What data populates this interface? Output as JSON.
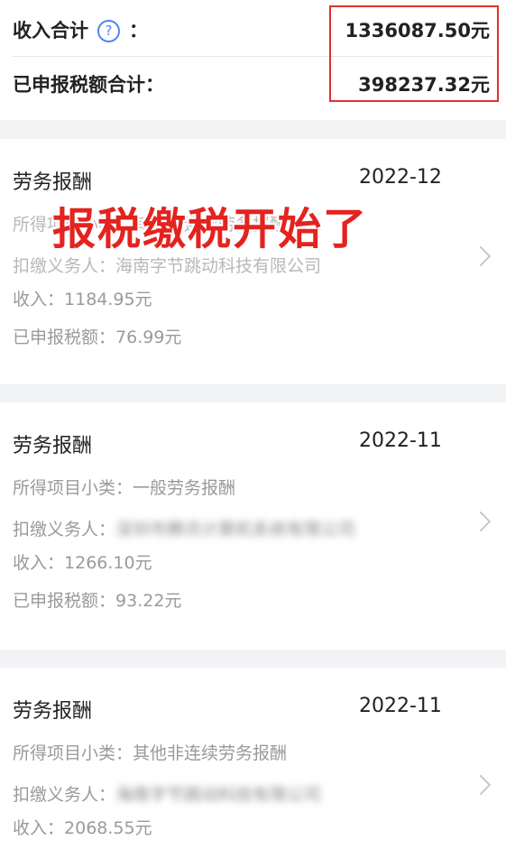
{
  "summary": {
    "income_label": "收入合计",
    "income_colon": "：",
    "income_value": "1336087.50元",
    "tax_label": "已申报税额合计：",
    "tax_value": "398237.32元"
  },
  "overlay_text": "报税缴税开始了",
  "records": [
    {
      "title": "劳务报酬",
      "date": "2022-12",
      "subcategory_label": "所得项目小类：",
      "subcategory_value": "其他非连续劳务报酬",
      "withholder_label": "扣缴义务人：",
      "withholder_value": "海南字节跳动科技有限公司",
      "income_label": "收入：",
      "income_value": "1184.95元",
      "tax_label": "已申报税额：",
      "tax_value": "76.99元"
    },
    {
      "title": "劳务报酬",
      "date": "2022-11",
      "subcategory_label": "所得项目小类：",
      "subcategory_value": "一般劳务报酬",
      "withholder_label": "扣缴义务人：",
      "withholder_value": "深圳市腾讯计算机系统有限公司",
      "income_label": "收入：",
      "income_value": "1266.10元",
      "tax_label": "已申报税额：",
      "tax_value": "93.22元"
    },
    {
      "title": "劳务报酬",
      "date": "2022-11",
      "subcategory_label": "所得项目小类：",
      "subcategory_value": "其他非连续劳务报酬",
      "withholder_label": "扣缴义务人：",
      "withholder_value": "海南字节跳动科技有限公司",
      "income_label": "收入：",
      "income_value": "2068.55元"
    }
  ],
  "icons": {
    "help": "help-circle-icon",
    "chevron": "chevron-right-icon"
  },
  "colors": {
    "accent": "#4f87f1",
    "highlight_border": "#e0322e",
    "overlay_text": "#e3231f"
  }
}
